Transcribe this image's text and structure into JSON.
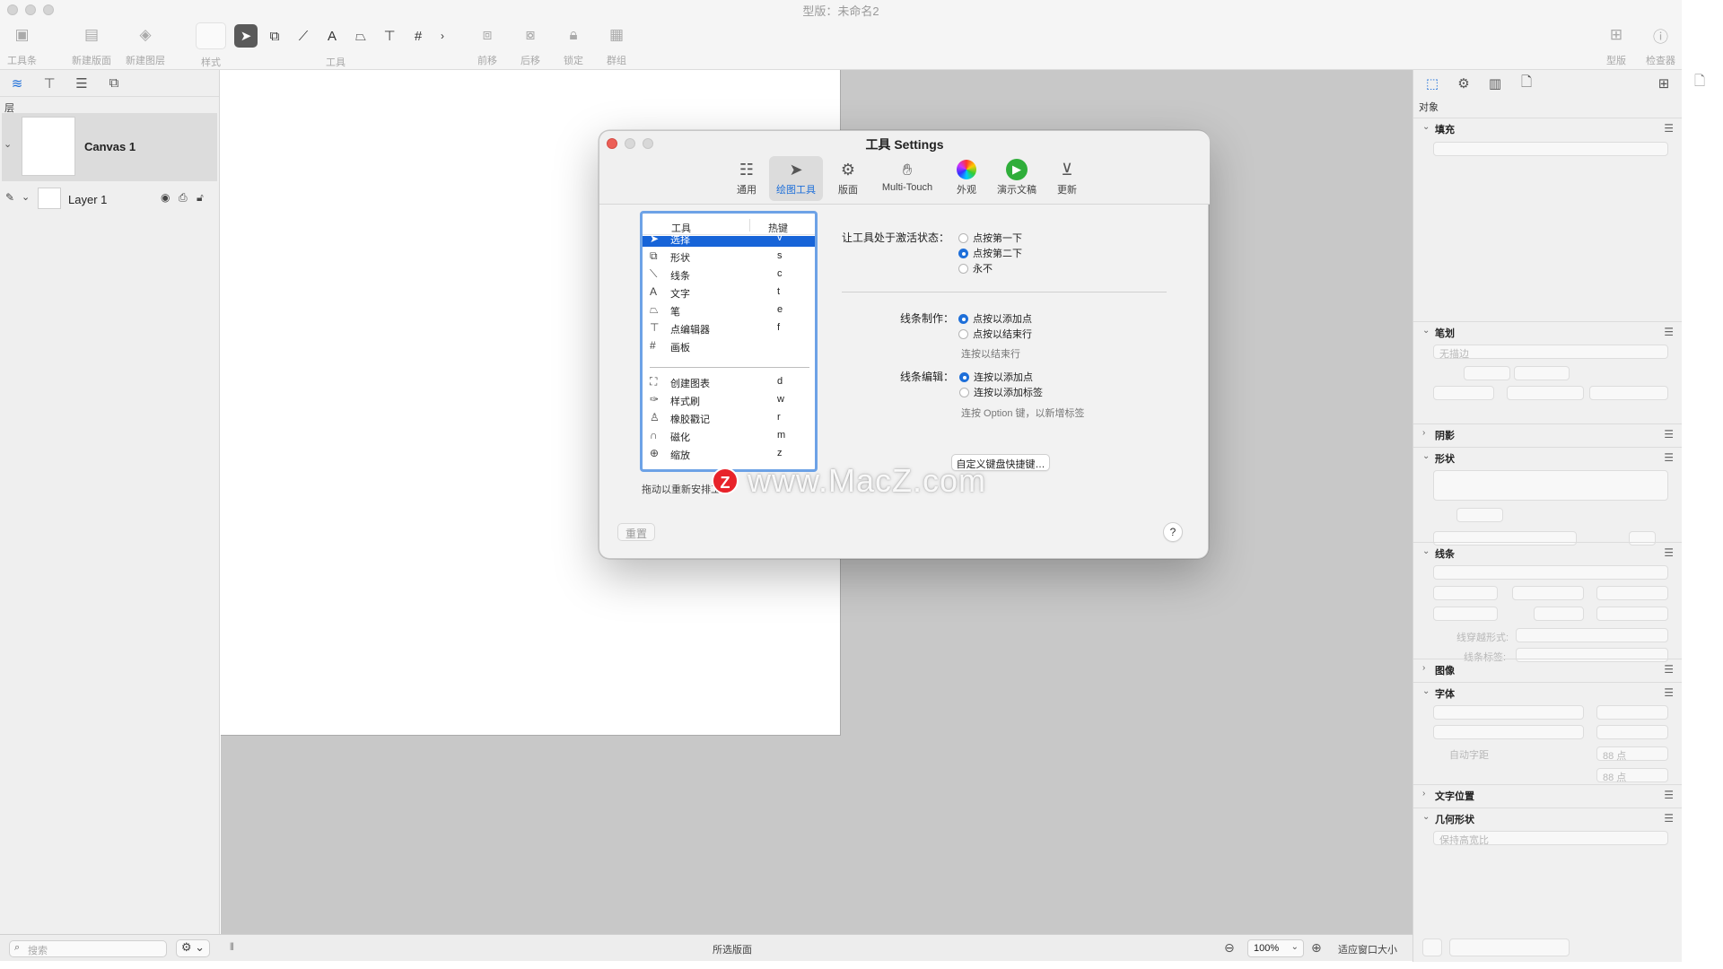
{
  "window": {
    "title": "型版：未命名2"
  },
  "toolbar": {
    "toolbar_btn": "工具条",
    "new_canvas": "新建版面",
    "new_layer": "新建图层",
    "style": "样式",
    "tools": "工具",
    "bring_forward": "前移",
    "send_back": "后移",
    "lock": "锁定",
    "group": "群组",
    "canvas_btn": "型版",
    "inspector_btn": "检查器"
  },
  "sidebar": {
    "layers_label": "层",
    "canvas_name": "Canvas 1",
    "layer_name": "Layer 1"
  },
  "status": {
    "search_placeholder": "搜索",
    "selection": "所选版面",
    "zoom": "100%",
    "fit": "适应窗口大小"
  },
  "inspector": {
    "object_label": "对象",
    "sections": {
      "fill": "填充",
      "stroke": "笔划",
      "shadow": "阴影",
      "shape": "形状",
      "lines": "线条",
      "image": "图像",
      "font": "字体",
      "text_position": "文字位置",
      "geometry": "几何形状"
    },
    "no_stroke": "无描边",
    "line_cross": "线穿越形式:",
    "line_labels": "线条标签:",
    "auto_kerning": "自动字距",
    "size_a": "88 点",
    "size_b": "88 点",
    "keep_ratio": "保持高宽比"
  },
  "dialog": {
    "title": "工具 Settings",
    "tabs": [
      "通用",
      "绘图工具",
      "版面",
      "Multi-Touch",
      "外观",
      "演示文稿",
      "更新"
    ],
    "active_tab": "绘图工具",
    "table_headers": {
      "tool": "工具",
      "hotkey": "热键"
    },
    "tools": [
      {
        "name": "选择",
        "key": "v",
        "icon": "arrow-icon"
      },
      {
        "name": "形状",
        "key": "s",
        "icon": "shape-icon"
      },
      {
        "name": "线条",
        "key": "c",
        "icon": "line-icon"
      },
      {
        "name": "文字",
        "key": "t",
        "icon": "text-icon"
      },
      {
        "name": "笔",
        "key": "e",
        "icon": "pen-icon"
      },
      {
        "name": "点编辑器",
        "key": "f",
        "icon": "point-editor-icon"
      },
      {
        "name": "画板",
        "key": "",
        "icon": "artboard-icon"
      }
    ],
    "tools2": [
      {
        "name": "创建图表",
        "key": "d",
        "icon": "diagram-icon"
      },
      {
        "name": "样式刷",
        "key": "w",
        "icon": "style-brush-icon"
      },
      {
        "name": "橡胶戳记",
        "key": "r",
        "icon": "rubber-stamp-icon"
      },
      {
        "name": "磁化",
        "key": "m",
        "icon": "magnet-icon"
      },
      {
        "name": "缩放",
        "key": "z",
        "icon": "zoom-icon"
      }
    ],
    "drag_hint": "拖动以重新安排工",
    "activate_label": "让工具处于激活状态：",
    "activate_options": [
      "点按第一下",
      "点按第二下",
      "永不"
    ],
    "line_make_label": "线条制作：",
    "line_make_options": [
      "点按以添加点",
      "点按以结束行"
    ],
    "line_make_hint": "连按以结束行",
    "line_edit_label": "线条编辑：",
    "line_edit_options": [
      "连按以添加点",
      "连按以添加标签"
    ],
    "line_edit_hint": "连按 Option 键，以新增标签",
    "shortcut_button": "自定义键盘快捷键…",
    "reset_button": "重置",
    "help_button": "?"
  },
  "watermark": {
    "logo": "Z",
    "text": "www.MacZ.com"
  },
  "colors": {
    "accent": "#1e6fd9",
    "selection": "#1764d8",
    "canvas_bg": "#c8c8c8"
  }
}
